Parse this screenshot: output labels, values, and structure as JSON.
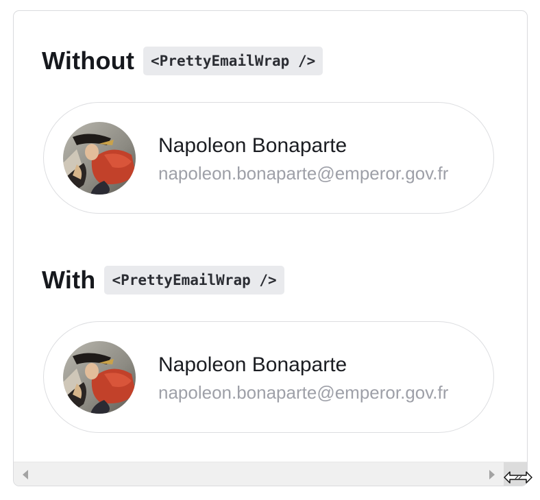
{
  "sections": [
    {
      "heading": "Without",
      "code": "<PrettyEmailWrap />",
      "card": {
        "name": "Napoleon Bonaparte",
        "email": "napoleon.bonaparte@emperor.gov.fr",
        "avatar_icon": "napoleon-portrait"
      }
    },
    {
      "heading": "With",
      "code": "<PrettyEmailWrap />",
      "card": {
        "name": "Napoleon Bonaparte",
        "email": "napoleon.bonaparte@emperor.gov.fr",
        "avatar_icon": "napoleon-portrait"
      }
    }
  ],
  "scrollbar": {
    "left_icon": "scroll-left-arrow-icon",
    "right_icon": "scroll-right-arrow-icon"
  },
  "cursor_icon": "horizontal-resize-cursor-icon",
  "colors": {
    "heading": "#16181d",
    "code_bg": "#e9eaed",
    "name": "#1b1d22",
    "email": "#9ea0a8",
    "card_border": "#dcdde0"
  }
}
